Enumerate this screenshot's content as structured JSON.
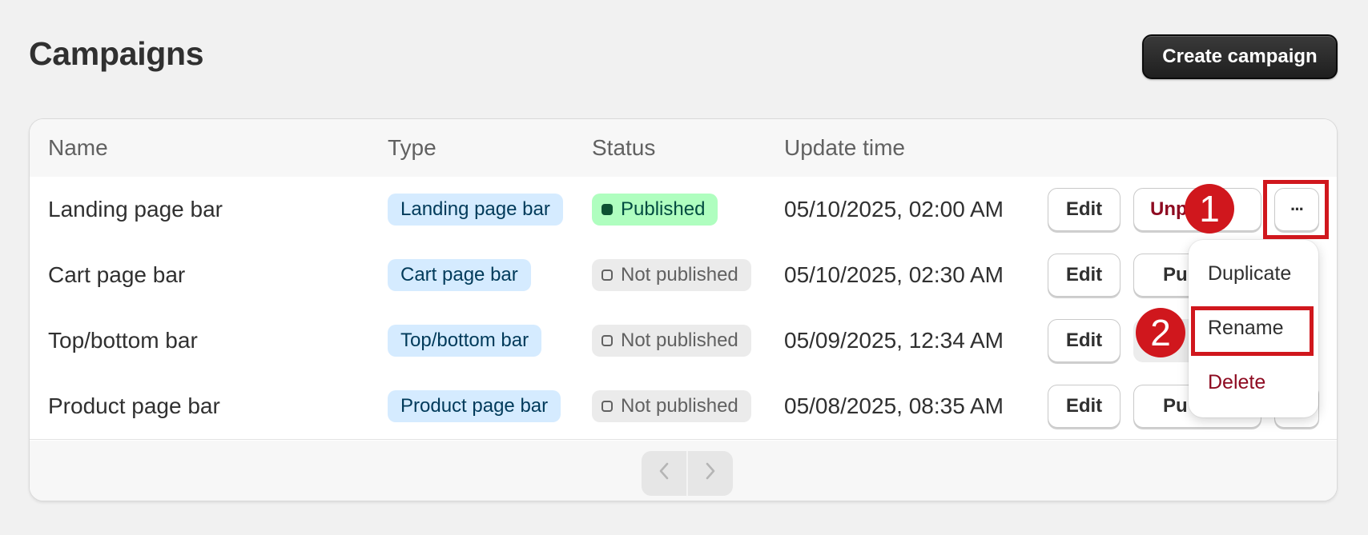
{
  "page": {
    "title": "Campaigns",
    "create_label": "Create campaign"
  },
  "table": {
    "headers": {
      "name": "Name",
      "type": "Type",
      "status": "Status",
      "update_time": "Update time"
    },
    "rows": [
      {
        "name": "Landing page bar",
        "type": "Landing page bar",
        "status": "Published",
        "update_time": "05/10/2025, 02:00 AM",
        "edit": "Edit",
        "toggle": "Unpub"
      },
      {
        "name": "Cart page bar",
        "type": "Cart page bar",
        "status": "Not published",
        "update_time": "05/10/2025, 02:30 AM",
        "edit": "Edit",
        "toggle": "Pu"
      },
      {
        "name": "Top/bottom bar",
        "type": "Top/bottom bar",
        "status": "Not published",
        "update_time": "05/09/2025, 12:34 AM",
        "edit": "Edit",
        "toggle": ""
      },
      {
        "name": "Product page bar",
        "type": "Product page bar",
        "status": "Not published",
        "update_time": "05/08/2025, 08:35 AM",
        "edit": "Edit",
        "toggle": "Pu"
      }
    ],
    "more_label": "···"
  },
  "menu": {
    "duplicate": "Duplicate",
    "rename": "Rename",
    "delete": "Delete"
  },
  "pagination": {
    "prev_icon": "chevron-left-icon",
    "next_icon": "chevron-right-icon"
  },
  "annotations": {
    "step1": "1",
    "step2": "2"
  },
  "colors": {
    "highlight": "#d0171d",
    "published_bg": "#affebf",
    "type_badge_bg": "#d5ebff",
    "danger_text": "#8e0b21"
  }
}
